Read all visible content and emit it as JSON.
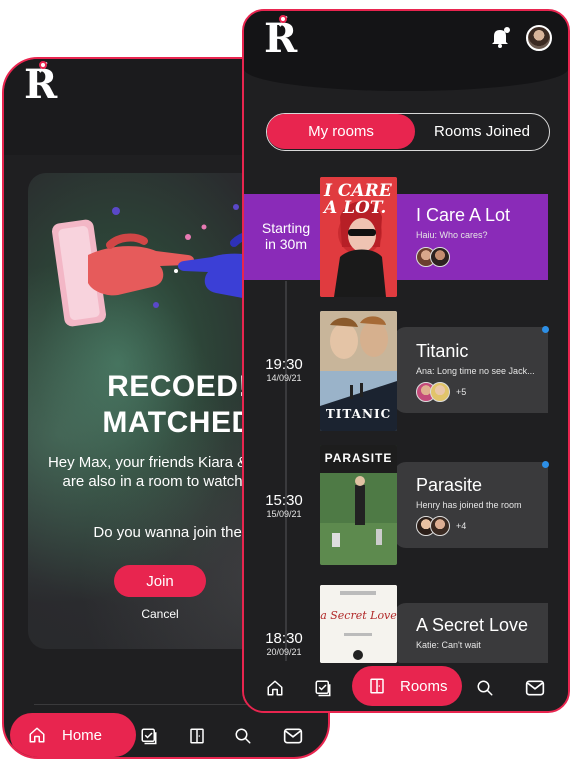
{
  "left_screen": {
    "match": {
      "title_line1": "RECOED!",
      "title_line2": "MATCHED",
      "message": "Hey Max, your friends Kiara & Neptune are also in a room to watch “Joker”",
      "question": "Do you wanna join them?",
      "join_label": "Join",
      "cancel_label": "Cancel"
    },
    "nav": {
      "home_label": "Home"
    }
  },
  "right_screen": {
    "tabs": {
      "active": "My rooms",
      "inactive": "Rooms Joined"
    },
    "rooms": [
      {
        "status": "Starting in 30m",
        "status_line1": "Starting",
        "status_line2": "in 30m",
        "title": "I Care A Lot",
        "subtitle": "Haiu: Who cares?",
        "poster_text": "I CARE A LOT.",
        "extra_count": ""
      },
      {
        "time": "19:30",
        "date": "14/09/21",
        "title": "Titanic",
        "subtitle": "Ana: Long time no see Jack...",
        "poster_text": "TITANIC",
        "extra_count": "+5"
      },
      {
        "time": "15:30",
        "date": "15/09/21",
        "title": "Parasite",
        "subtitle": "Henry has joined the room",
        "poster_text": "PARASITE",
        "extra_count": "+4"
      },
      {
        "time": "18:30",
        "date": "20/09/21",
        "title": "A Secret Love",
        "subtitle": "Katie: Can't wait",
        "poster_text": "a Secret Love",
        "extra_count": ""
      }
    ],
    "nav": {
      "rooms_label": "Rooms"
    }
  },
  "icons": [
    "logo-icon",
    "bell-icon",
    "avatar",
    "home-icon",
    "checklist-icon",
    "door-icon",
    "search-icon",
    "mail-icon"
  ],
  "colors": {
    "accent": "#e8254f",
    "live_room": "#8a2bb8",
    "background": "#1f1f21",
    "card": "#3a3a3c",
    "unread_dot": "#2d8fe6"
  }
}
